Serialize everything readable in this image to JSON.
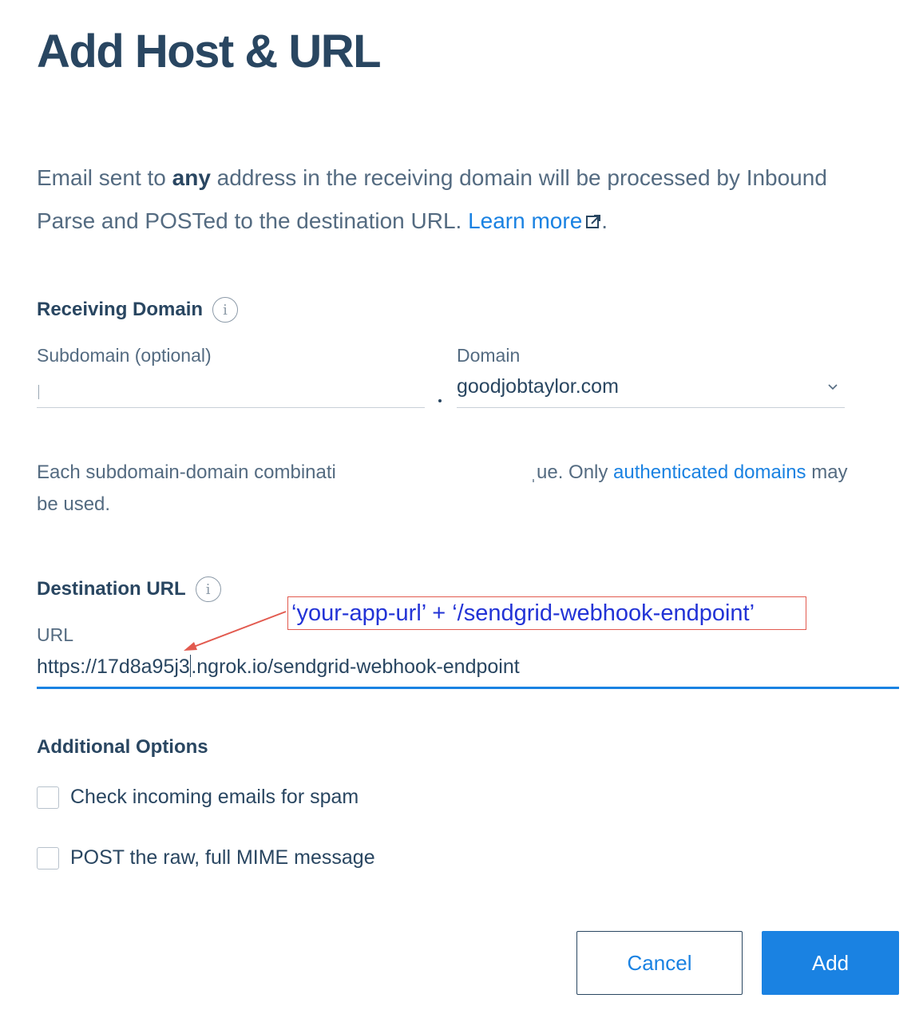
{
  "page": {
    "title": "Add Host & URL"
  },
  "intro": {
    "before_bold": "Email sent to ",
    "bold": "any",
    "after_bold": " address in the receiving domain will be processed by Inbound Parse and POSTed to the destination URL. ",
    "link_label": "Learn more",
    "end": "."
  },
  "receiving_domain": {
    "heading": "Receiving Domain",
    "info_glyph": "i",
    "subdomain_label": "Subdomain (optional)",
    "subdomain_value": "",
    "separator": ".",
    "domain_label": "Domain",
    "domain_selected": "goodjobtaylor.com",
    "help_start": "Each subdomain-domain combinati",
    "help_tail_start": "ˌue. Only ",
    "help_link": "authenticated domains",
    "help_tail_end": " may",
    "help_line2": "be used."
  },
  "destination": {
    "heading": "Destination URL",
    "info_glyph": "i",
    "url_label": "URL",
    "url_before_caret": "https://17d8a95j3",
    "url_after_caret": ".ngrok.io/sendgrid-webhook-endpoint"
  },
  "annotation": {
    "text": "‘your-app-url’ + ‘/sendgrid-webhook-endpoint’",
    "color": "#2233d6",
    "border_color": "#e25a4f"
  },
  "options": {
    "heading": "Additional Options",
    "items": [
      {
        "label": "Check incoming emails for spam",
        "checked": false
      },
      {
        "label": "POST the raw, full MIME message",
        "checked": false
      }
    ]
  },
  "buttons": {
    "cancel": "Cancel",
    "add": "Add"
  },
  "colors": {
    "primary": "#1a82e2",
    "heading": "#294661",
    "body": "#546b81"
  }
}
